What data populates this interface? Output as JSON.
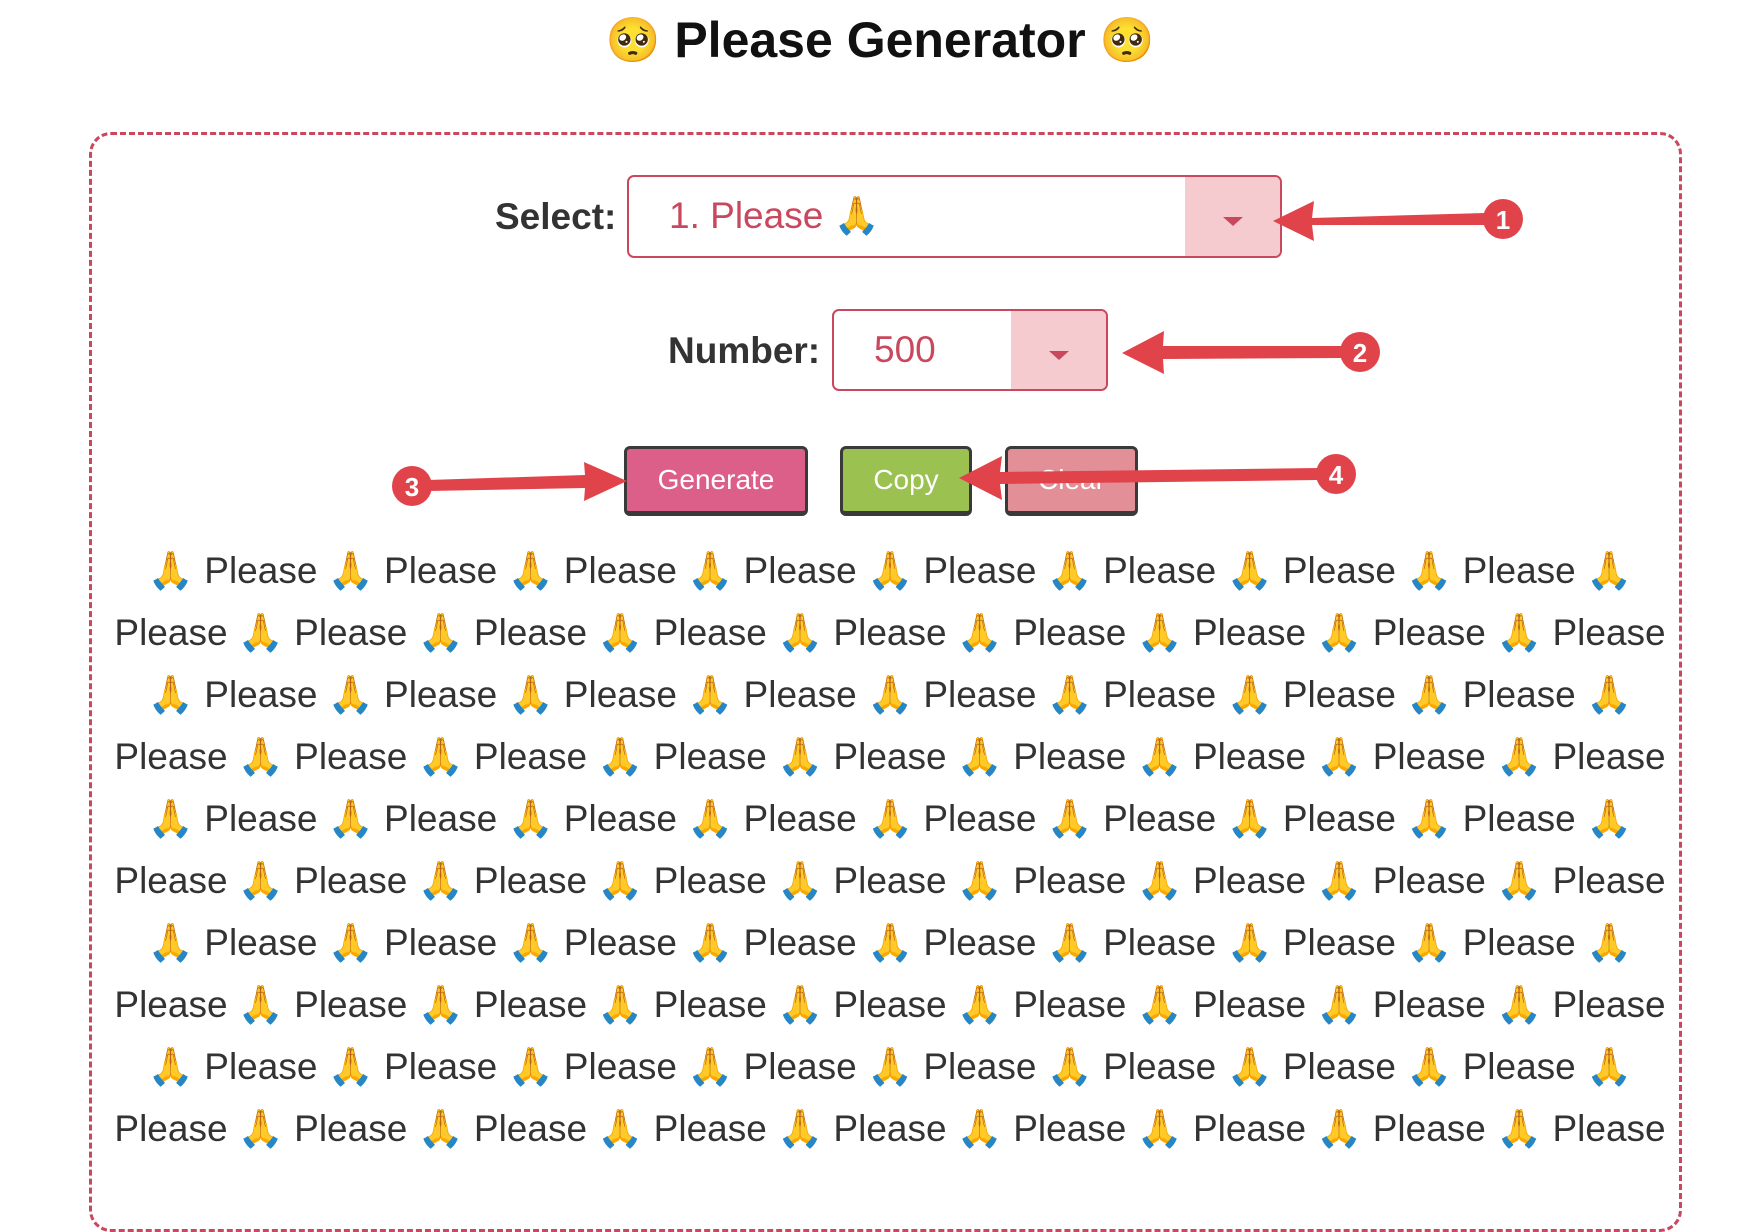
{
  "header": {
    "title": "Please Generator",
    "emoji_left": "🥺",
    "emoji_right": "🥺"
  },
  "form": {
    "select_label": "Select:",
    "select_value": "1. Please 🙏",
    "number_label": "Number:",
    "number_value": "500"
  },
  "buttons": {
    "generate": "Generate",
    "copy": "Copy",
    "clear": "Clear"
  },
  "output": {
    "lines": [
      "🙏 Please 🙏 Please 🙏 Please 🙏 Please 🙏 Please 🙏 Please 🙏 Please 🙏 Please 🙏",
      "Please 🙏 Please 🙏 Please 🙏 Please 🙏 Please 🙏 Please 🙏 Please 🙏 Please 🙏 Please",
      "🙏 Please 🙏 Please 🙏 Please 🙏 Please 🙏 Please 🙏 Please 🙏 Please 🙏 Please 🙏",
      "Please 🙏 Please 🙏 Please 🙏 Please 🙏 Please 🙏 Please 🙏 Please 🙏 Please 🙏 Please",
      "🙏 Please 🙏 Please 🙏 Please 🙏 Please 🙏 Please 🙏 Please 🙏 Please 🙏 Please 🙏",
      "Please 🙏 Please 🙏 Please 🙏 Please 🙏 Please 🙏 Please 🙏 Please 🙏 Please 🙏 Please",
      "🙏 Please 🙏 Please 🙏 Please 🙏 Please 🙏 Please 🙏 Please 🙏 Please 🙏 Please 🙏",
      "Please 🙏 Please 🙏 Please 🙏 Please 🙏 Please 🙏 Please 🙏 Please 🙏 Please 🙏 Please",
      "🙏 Please 🙏 Please 🙏 Please 🙏 Please 🙏 Please 🙏 Please 🙏 Please 🙏 Please 🙏",
      "Please 🙏 Please 🙏 Please 🙏 Please 🙏 Please 🙏 Please 🙏 Please 🙏 Please 🙏 Please"
    ]
  },
  "annotations": {
    "color": "#e0434a",
    "badges": [
      "1",
      "2",
      "3",
      "4"
    ]
  },
  "colors": {
    "accent": "#c9485d",
    "dropdown_bg": "#f5cbd0",
    "generate_bg": "#dc5f8a",
    "copy_bg": "#9bc151",
    "clear_bg": "#e38f97"
  }
}
